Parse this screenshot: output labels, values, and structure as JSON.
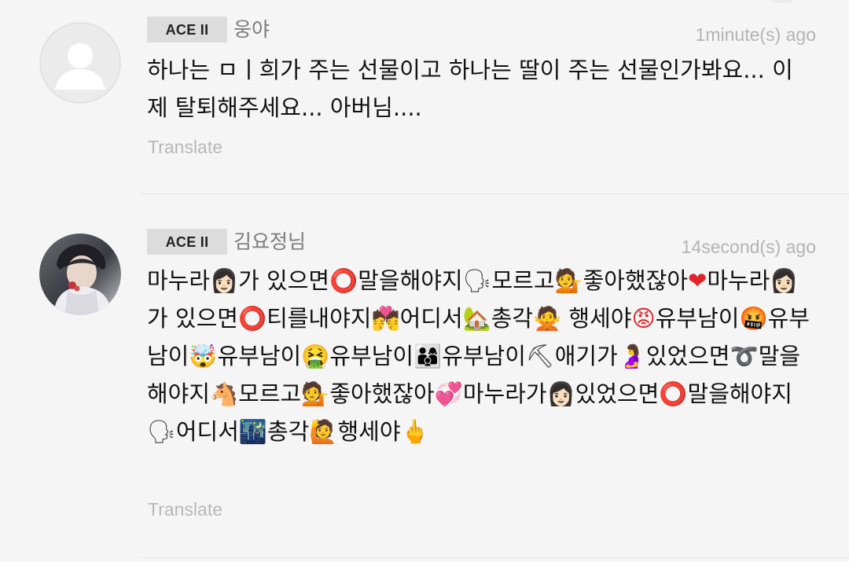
{
  "comments": [
    {
      "badge": "ACE II",
      "username": "웅야",
      "time": "1minute(s) ago",
      "text": "하나는 ㅁㅣ희가 주는 선물이고 하나는 딸이 주는 선물인가봐요... 이제 탈퇴해주세요... 아버님....",
      "translate": "Translate",
      "avatar": "default-avatar-icon"
    },
    {
      "badge": "ACE II",
      "username": "김요정님",
      "time": "14second(s) ago",
      "translate": "Translate",
      "avatar": "user-photo",
      "segments": [
        {
          "t": "마누라"
        },
        {
          "e": "👩🏻",
          "c": "dark"
        },
        {
          "t": "가 있으면"
        },
        {
          "e": "⭕",
          "c": "red"
        },
        {
          "t": "말을해야지"
        },
        {
          "e": "🗣",
          "c": "dark"
        },
        {
          "t": "모르고"
        },
        {
          "e": "💁",
          "c": "brown"
        },
        {
          "t": "좋아했잖아"
        },
        {
          "e": "❤",
          "c": "red"
        },
        {
          "t": "마누라"
        },
        {
          "e": "👩🏻",
          "c": "dark"
        },
        {
          "t": "가 있으면"
        },
        {
          "e": "⭕",
          "c": "red"
        },
        {
          "t": "티를내야지"
        },
        {
          "e": "💏",
          "c": "pink"
        },
        {
          "t": "어디서"
        },
        {
          "e": "🏡",
          "c": "green"
        },
        {
          "t": "총각"
        },
        {
          "e": "🙅",
          "c": "brown"
        },
        {
          "t": " 행세야"
        },
        {
          "e": "😡",
          "c": "red"
        },
        {
          "t": "유부남이"
        },
        {
          "e": "🤬",
          "c": "red"
        },
        {
          "t": "유부남이"
        },
        {
          "e": "🤯",
          "c": "yellow"
        },
        {
          "t": "유부남이"
        },
        {
          "e": "🤮",
          "c": "green"
        },
        {
          "t": "유부남이"
        },
        {
          "e": "👨‍👩‍👦",
          "c": "brown"
        },
        {
          "t": "유부남이"
        },
        {
          "e": "⛏",
          "c": "dark"
        },
        {
          "t": "애기가"
        },
        {
          "e": "🤰",
          "c": "brown"
        },
        {
          "t": "있었으면"
        },
        {
          "e": "➰",
          "c": "dark"
        },
        {
          "t": "말을해야지"
        },
        {
          "e": "🐴",
          "c": "brown"
        },
        {
          "t": "모르고"
        },
        {
          "e": "💁",
          "c": "brown"
        },
        {
          "t": "좋아했잖아"
        },
        {
          "e": "💞",
          "c": "pink"
        },
        {
          "t": "마누라가"
        },
        {
          "e": "👩🏻",
          "c": "dark"
        },
        {
          "t": "있었으면"
        },
        {
          "e": "⭕",
          "c": "red"
        },
        {
          "t": "말을해야지"
        },
        {
          "e": "🗣",
          "c": "dark"
        },
        {
          "t": "어디서"
        },
        {
          "e": "🌃",
          "c": "dark"
        },
        {
          "t": "총각"
        },
        {
          "e": "🙋",
          "c": "brown"
        },
        {
          "t": "행세야"
        },
        {
          "e": "🖕",
          "c": "yellow"
        }
      ]
    }
  ]
}
